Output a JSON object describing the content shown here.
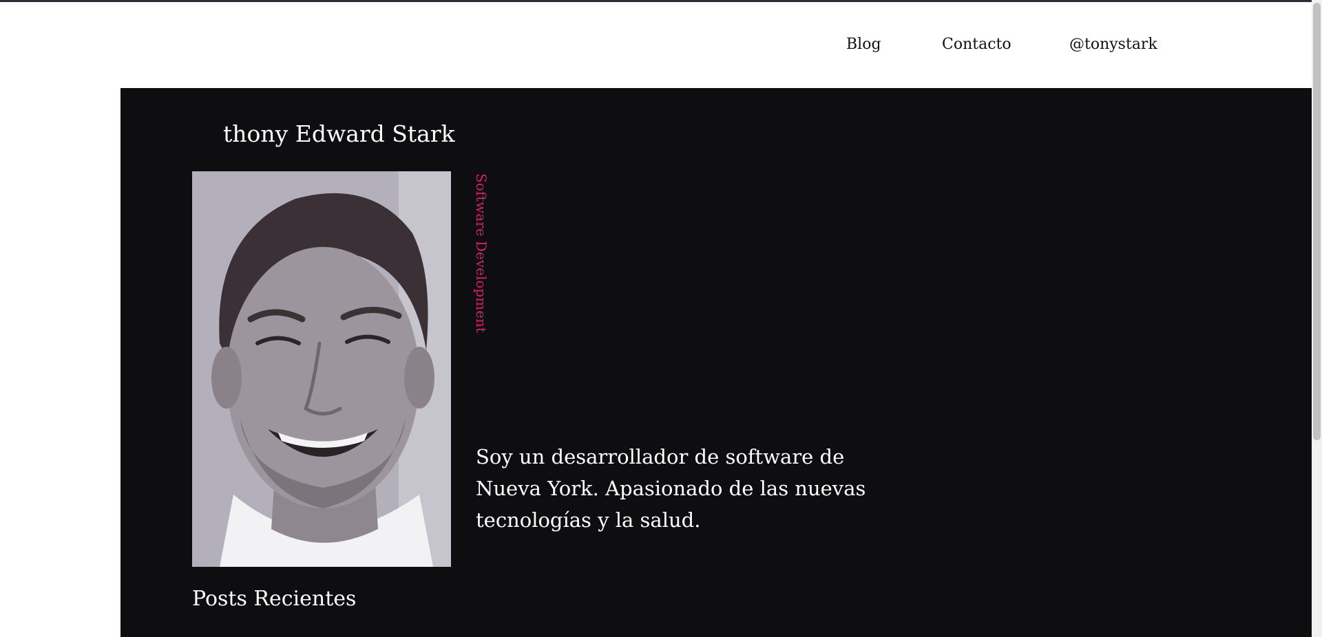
{
  "nav": {
    "items": [
      {
        "label": "Blog"
      },
      {
        "label": "Contacto"
      },
      {
        "label": "@tonystark"
      }
    ]
  },
  "hero": {
    "name": "thony Edward Stark",
    "role": "Software Development",
    "bio": "Soy un desarrollador de software de Nueva York. Apasionado de las nuevas tecnologías y la salud.",
    "portrait_icon": "portrait-photo"
  },
  "recent_posts": {
    "heading": "Posts Recientes",
    "items": [
      {
        "date": "",
        "title": ""
      }
    ]
  },
  "colors": {
    "hero_background": "#0e0e10",
    "accent": "#d61f6c",
    "text_light": "#ffffff",
    "text_dark": "#111111"
  }
}
